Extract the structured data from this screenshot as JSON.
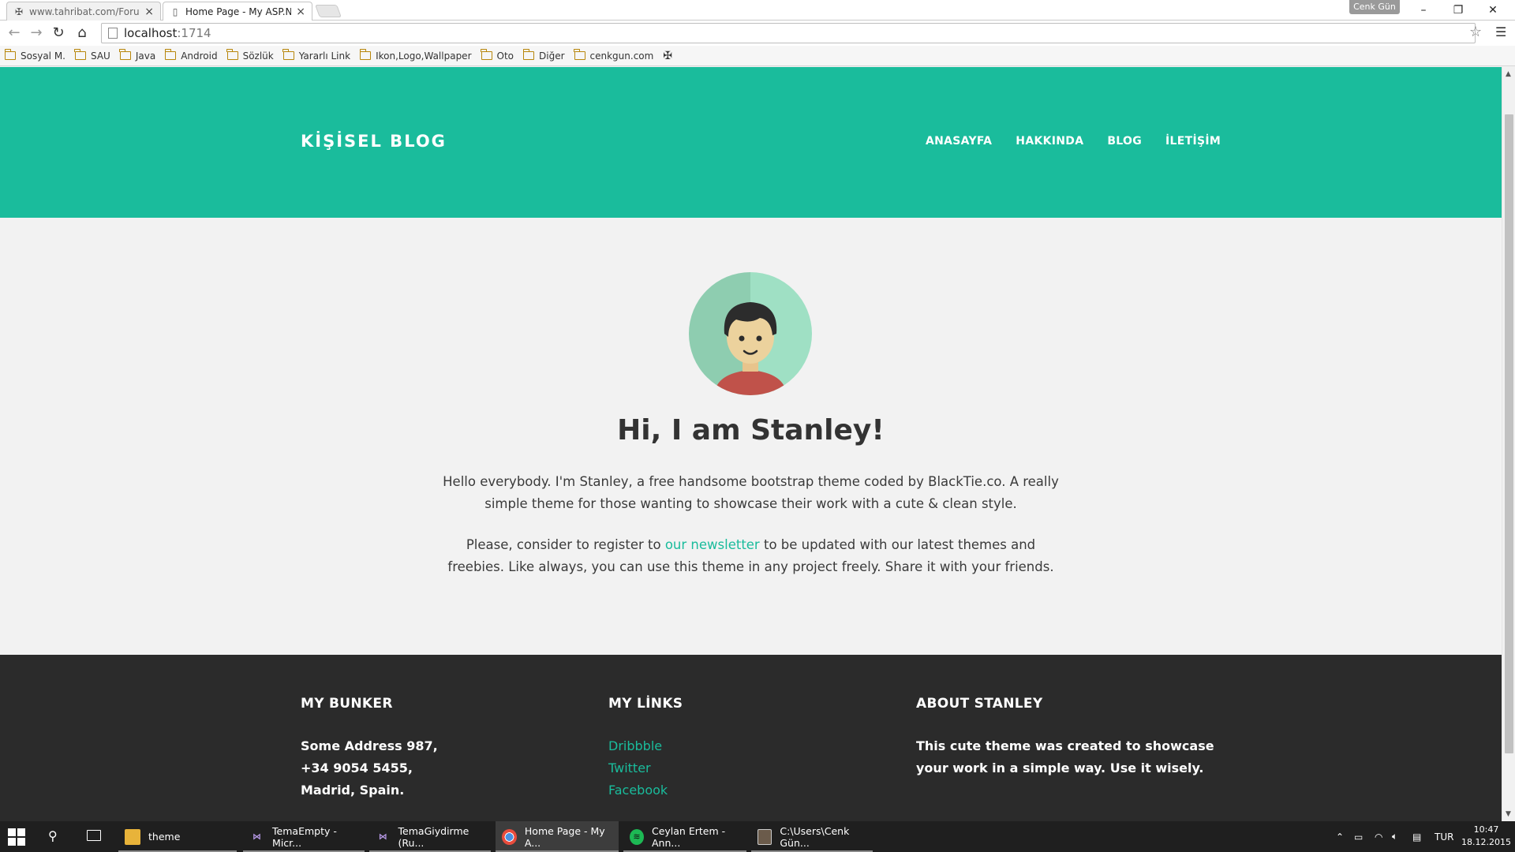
{
  "browser": {
    "tabs": [
      {
        "label": "www.tahribat.com/Forum/",
        "active": false
      },
      {
        "label": "Home Page - My ASP.NET",
        "active": true
      }
    ],
    "profile_name": "Cenk Gün",
    "url_host": "localhost",
    "url_port": ":1714",
    "bookmarks": [
      "Sosyal M.",
      "SAU",
      "Java",
      "Android",
      "Sözlük",
      "Yararlı Link",
      "Ikon,Logo,Wallpaper",
      "Oto",
      "Diğer",
      "cenkgun.com"
    ]
  },
  "site": {
    "brand": "KİŞİSEL BLOG",
    "nav": [
      "ANASAYFA",
      "HAKKINDA",
      "BLOG",
      "İLETİŞİM"
    ],
    "headline": "Hi, I am Stanley!",
    "intro": "Hello everybody. I'm Stanley, a free handsome bootstrap theme coded by BlackTie.co. A really simple theme for those wanting to showcase their work with a cute & clean style.",
    "newsletter_before": "Please, consider to register to ",
    "newsletter_link": "our newsletter",
    "newsletter_after": " to be updated with our latest themes and freebies. Like always, you can use this theme in any project freely. Share it with your friends.",
    "accent_color": "#1abc9c",
    "footer": {
      "bunker": {
        "heading": "MY BUNKER",
        "lines": [
          "Some Address 987,",
          "+34 9054 5455,",
          "Madrid, Spain."
        ]
      },
      "links": {
        "heading": "MY LİNKS",
        "items": [
          "Dribbble",
          "Twitter",
          "Facebook"
        ]
      },
      "about": {
        "heading": "ABOUT STANLEY",
        "lines": [
          "This cute theme was created to showcase",
          "your work in a simple way. Use it wisely."
        ]
      }
    }
  },
  "taskbar": {
    "items": [
      {
        "label": "theme",
        "icon": "folder-icon"
      },
      {
        "label": "TemaEmpty - Micr...",
        "icon": "visual-studio-icon"
      },
      {
        "label": "TemaGiydirme (Ru...",
        "icon": "visual-studio-icon"
      },
      {
        "label": "Home Page - My A...",
        "icon": "chrome-icon"
      },
      {
        "label": "Ceylan Ertem - Ann...",
        "icon": "spotify-icon"
      },
      {
        "label": "C:\\Users\\Cenk Gün...",
        "icon": "terminal-icon"
      }
    ],
    "language": "TUR",
    "time": "10:47",
    "date": "18.12.2015"
  }
}
